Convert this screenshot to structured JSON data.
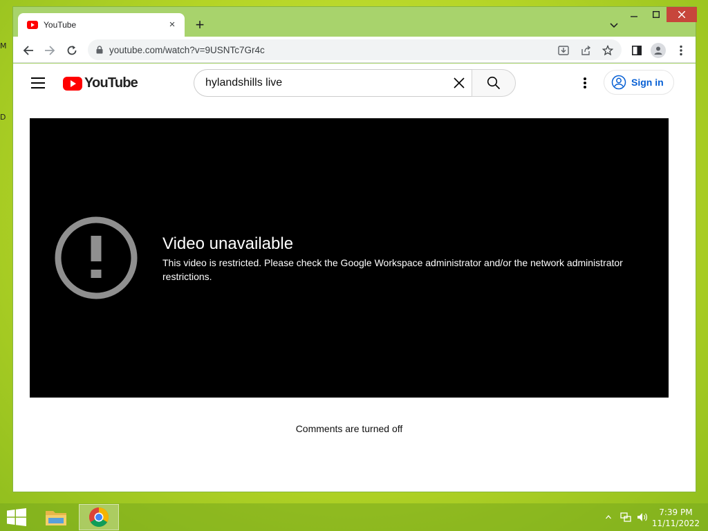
{
  "desktop": {
    "edge_letters": [
      "M",
      "D"
    ]
  },
  "browser": {
    "tab": {
      "title": "YouTube",
      "close_icon": "×",
      "favicon": "youtube-icon"
    },
    "new_tab_icon": "+",
    "address": {
      "url": "youtube.com/watch?v=9USNTc7Gr4c"
    },
    "window_controls": {
      "minimize": "–",
      "maximize": "□",
      "close": "✕"
    }
  },
  "youtube": {
    "logo_text": "YouTube",
    "search": {
      "value": "hylandshills live"
    },
    "sign_in_label": "Sign in",
    "player": {
      "error_title": "Video unavailable",
      "error_message": "This video is restricted. Please check the Google Workspace administrator and/or the network administrator restrictions."
    },
    "comments_text": "Comments are turned off"
  },
  "taskbar": {
    "time": "7:39 PM",
    "date": "11/11/2022"
  },
  "colors": {
    "youtube_red": "#ff0000",
    "link_blue": "#065fd4",
    "close_red": "#c7463b",
    "desktop_green": "#b4d426"
  }
}
